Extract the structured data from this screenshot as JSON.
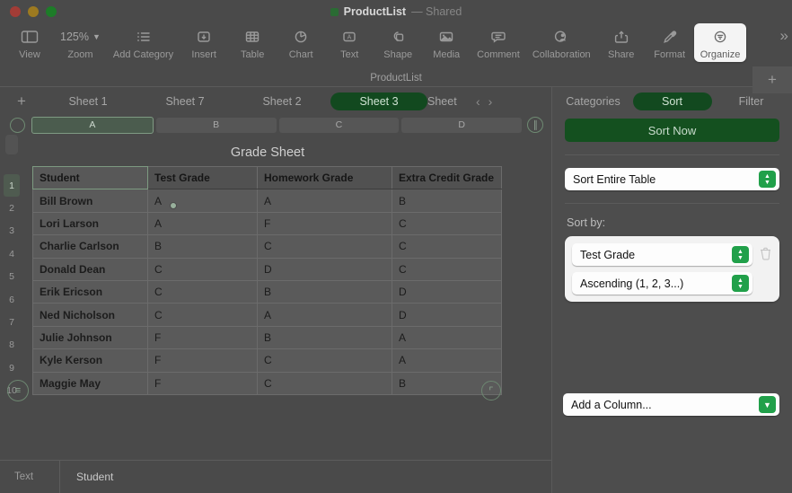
{
  "window": {
    "title": "ProductList",
    "shared_label": "— Shared",
    "traffic_lights": [
      "close-button",
      "minimize-button",
      "zoom-button"
    ]
  },
  "toolbar": {
    "items": [
      {
        "label": "View",
        "icon": "sidebar-icon"
      },
      {
        "label": "Zoom",
        "icon": "zoom-icon",
        "value": "125%"
      },
      {
        "label": "Add Category",
        "icon": "list-icon"
      },
      {
        "label": "Insert",
        "icon": "insert-icon"
      },
      {
        "label": "Table",
        "icon": "table-icon"
      },
      {
        "label": "Chart",
        "icon": "chart-icon"
      },
      {
        "label": "Text",
        "icon": "text-icon"
      },
      {
        "label": "Shape",
        "icon": "shape-icon"
      },
      {
        "label": "Media",
        "icon": "media-icon"
      },
      {
        "label": "Comment",
        "icon": "comment-icon"
      },
      {
        "label": "Collaboration",
        "icon": "collaboration-icon"
      },
      {
        "label": "Share",
        "icon": "share-icon"
      },
      {
        "label": "Format",
        "icon": "format-brush-icon"
      },
      {
        "label": "Organize",
        "icon": "organize-icon",
        "active": true
      }
    ],
    "overflow_label": "»"
  },
  "doc_strip": {
    "name": "ProductList",
    "add_button": "+"
  },
  "sheet_tabs": {
    "add_label": "+",
    "tabs": [
      {
        "label": "Sheet 1",
        "selected": false
      },
      {
        "label": "Sheet 7",
        "selected": false
      },
      {
        "label": "Sheet 2",
        "selected": false
      },
      {
        "label": "Sheet 3",
        "selected": true
      },
      {
        "label": "Sheet",
        "selected": false
      }
    ],
    "prev_label": "‹",
    "next_label": "›"
  },
  "columns": {
    "headers": [
      "A",
      "B",
      "C",
      "D"
    ],
    "selected_index": 0
  },
  "sheet": {
    "title": "Grade Sheet",
    "row_numbers": [
      "1",
      "2",
      "3",
      "4",
      "5",
      "6",
      "7",
      "8",
      "9",
      "10"
    ],
    "selected_row_index": 0,
    "table": {
      "headers": [
        "Student",
        "Test Grade",
        "Homework Grade",
        "Extra Credit Grade"
      ],
      "rows": [
        [
          "Bill Brown",
          "A",
          "A",
          "B"
        ],
        [
          "Lori Larson",
          "A",
          "F",
          "C"
        ],
        [
          "Charlie Carlson",
          "B",
          "C",
          "C"
        ],
        [
          "Donald Dean",
          "C",
          "D",
          "C"
        ],
        [
          "Erik Ericson",
          "C",
          "B",
          "D"
        ],
        [
          "Ned Nicholson",
          "C",
          "A",
          "D"
        ],
        [
          "Julie Johnson",
          "F",
          "B",
          "A"
        ],
        [
          "Kyle Kerson",
          "F",
          "C",
          "A"
        ],
        [
          "Maggie May",
          "F",
          "C",
          "B"
        ]
      ]
    }
  },
  "status_bar": {
    "type_label": "Text",
    "value": "Student"
  },
  "panel": {
    "segments": [
      {
        "label": "Categories",
        "selected": false
      },
      {
        "label": "Sort",
        "selected": true
      },
      {
        "label": "Filter",
        "selected": false
      }
    ],
    "sort_now_label": "Sort Now",
    "scope_select": "Sort Entire Table",
    "sort_by_label": "Sort by:",
    "rules": [
      {
        "column": "Test Grade",
        "order": "Ascending (1, 2, 3...)"
      }
    ],
    "add_column_label": "Add a Column..."
  },
  "colors": {
    "accent_green": "#14501f",
    "stepper_green": "#21a04a",
    "window_bg": "#4a4a4a",
    "panel_bg": "#4d4d4d",
    "cell_bg": "#5a5a5a"
  }
}
